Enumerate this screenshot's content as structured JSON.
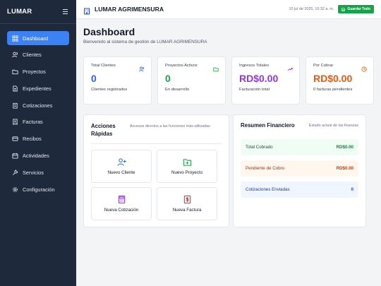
{
  "colors": {
    "sidebar_bg": "#1e293b",
    "accent_blue": "#3b82f6",
    "green": "#16a34a",
    "purple": "#9333ea",
    "orange": "#ea580c"
  },
  "sidebar": {
    "logo": "LUMAR",
    "menu_icon": "hamburger-icon",
    "items": [
      {
        "label": "Dashboard",
        "icon": "grid-icon",
        "active": true
      },
      {
        "label": "Clientes",
        "icon": "users-icon"
      },
      {
        "label": "Proyectos",
        "icon": "folder-icon"
      },
      {
        "label": "Expedientes",
        "icon": "file-icon"
      },
      {
        "label": "Cotizaciones",
        "icon": "clipboard-icon"
      },
      {
        "label": "Facturas",
        "icon": "receipt-icon"
      },
      {
        "label": "Recibos",
        "icon": "credit-card-icon"
      },
      {
        "label": "Actividades",
        "icon": "calendar-icon"
      },
      {
        "label": "Servicios",
        "icon": "wrench-icon"
      },
      {
        "label": "Configuración",
        "icon": "gear-icon"
      }
    ]
  },
  "header": {
    "brand_icon": "building-icon",
    "title": "LUMAR AGRIMENSURA",
    "datetime": "10 jul de 2025, 10:32 a. m.",
    "save_label": "Guardar Todo",
    "save_icon": "save-icon"
  },
  "main": {
    "title": "Dashboard",
    "subtitle": "Bienvenido al sistema de gestión de LUMAR AGRIMENSURA",
    "stats": [
      {
        "title": "Total Clientes",
        "value": "0",
        "desc": "Clientes registrados",
        "color": "#2563eb",
        "icon": "users-icon"
      },
      {
        "title": "Proyectos Activos",
        "value": "0",
        "desc": "En desarrollo",
        "color": "#16a34a",
        "icon": "folder-icon"
      },
      {
        "title": "Ingresos Totales",
        "value": "RD$0.00",
        "desc": "Facturación total",
        "color": "#9333ea",
        "icon": "trending-up-icon"
      },
      {
        "title": "Por Cobrar",
        "value": "RD$0.00",
        "desc": "0 facturas pendientes",
        "color": "#ea580c",
        "icon": "clock-icon"
      }
    ],
    "quick_actions": {
      "title": "Acciones Rápidas",
      "subtitle": "Accesos directos a las funciones más utilizadas",
      "buttons": [
        {
          "label": "Nuevo Cliente",
          "icon": "user-plus-icon",
          "color": "#2563eb"
        },
        {
          "label": "Nuevo Proyecto",
          "icon": "folder-plus-icon",
          "color": "#16a34a"
        },
        {
          "label": "Nueva Cotización",
          "icon": "calculator-icon",
          "color": "#9333ea"
        },
        {
          "label": "Nueva Factura",
          "icon": "dollar-file-icon",
          "color": "#dc2626"
        }
      ]
    },
    "financial": {
      "title": "Resumen Financiero",
      "subtitle": "Estado actual de las finanzas",
      "rows": [
        {
          "label": "Total Cobrado",
          "value": "RD$0.00",
          "bg": "#f0fdf4",
          "label_color": "#14532d",
          "value_color": "#15803d"
        },
        {
          "label": "Pendiente de Cobro",
          "value": "RD$0.00",
          "bg": "#fff7ed",
          "label_color": "#9a3412",
          "value_color": "#c2410c"
        },
        {
          "label": "Cotizaciones Enviadas",
          "value": "0",
          "bg": "#eff6ff",
          "label_color": "#1e3a8a",
          "value_color": "#1d4ed8"
        }
      ]
    }
  }
}
